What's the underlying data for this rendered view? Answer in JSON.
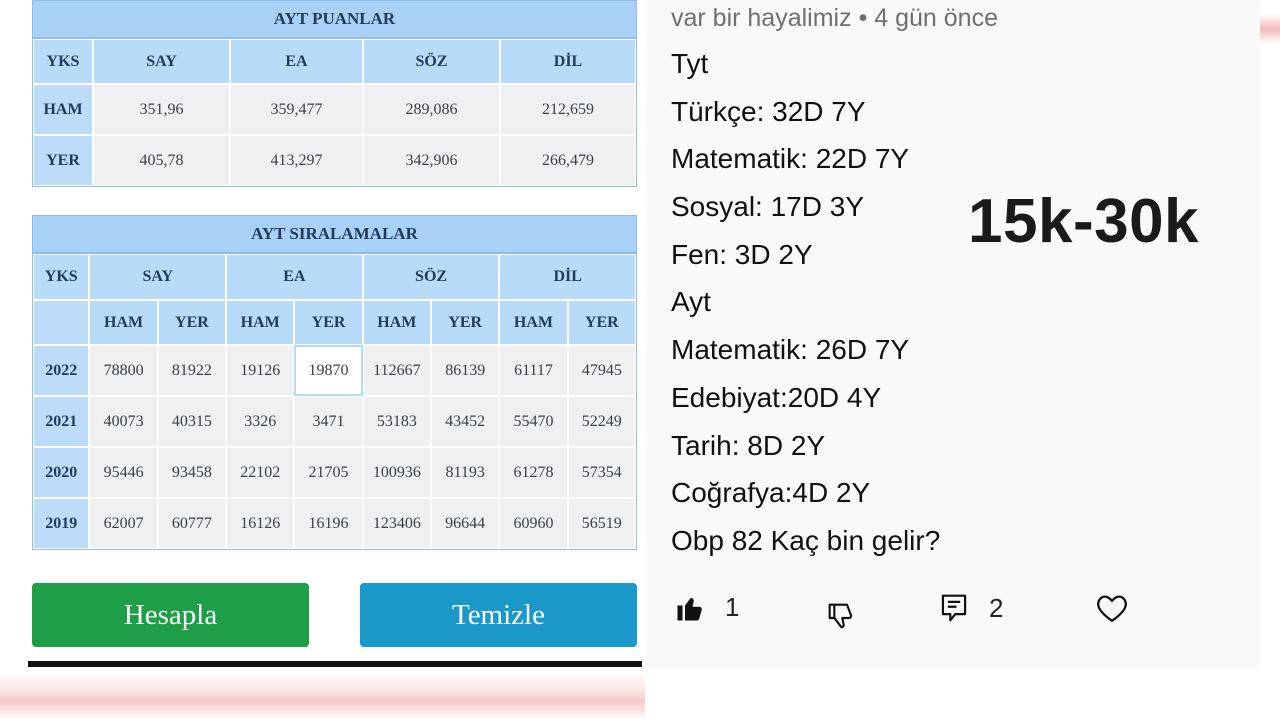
{
  "puanlar": {
    "title": "AYT PUANLAR",
    "header": [
      "YKS",
      "SAY",
      "EA",
      "SÖZ",
      "DİL"
    ],
    "rows": [
      {
        "label": "HAM",
        "values": [
          "351,96",
          "359,477",
          "289,086",
          "212,659"
        ]
      },
      {
        "label": "YER",
        "values": [
          "405,78",
          "413,297",
          "342,906",
          "266,479"
        ]
      }
    ]
  },
  "siralamalar": {
    "title": "AYT SIRALAMALAR",
    "yks_label": "YKS",
    "groups": [
      "SAY",
      "EA",
      "SÖZ",
      "DİL"
    ],
    "sub": [
      "HAM",
      "YER",
      "HAM",
      "YER",
      "HAM",
      "YER",
      "HAM",
      "YER"
    ],
    "rows": [
      {
        "year": "2022",
        "values": [
          "78800",
          "81922",
          "19126",
          "19870",
          "112667",
          "86139",
          "61117",
          "47945"
        ]
      },
      {
        "year": "2021",
        "values": [
          "40073",
          "40315",
          "3326",
          "3471",
          "53183",
          "43452",
          "55470",
          "52249"
        ]
      },
      {
        "year": "2020",
        "values": [
          "95446",
          "93458",
          "22102",
          "21705",
          "100936",
          "81193",
          "61278",
          "57354"
        ]
      },
      {
        "year": "2019",
        "values": [
          "62007",
          "60777",
          "16126",
          "16196",
          "123406",
          "96644",
          "60960",
          "56519"
        ]
      }
    ]
  },
  "buttons": {
    "calculate": "Hesapla",
    "clear": "Temizle"
  },
  "comment": {
    "author": "var bir hayalimiz",
    "time": "4 gün önce",
    "lines": [
      "Tyt",
      "Türkçe: 32D 7Y",
      "Matematik: 22D 7Y",
      "Sosyal: 17D 3Y",
      "Fen: 3D 2Y",
      "Ayt",
      "Matematik: 26D 7Y",
      "Edebiyat:20D 4Y",
      "Tarih: 8D 2Y",
      "Coğrafya:4D 2Y",
      "Obp 82 Kaç bin gelir?"
    ],
    "likes": "1",
    "replies": "2"
  },
  "overlay": {
    "range": "15k-30k"
  },
  "colors": {
    "calculate": "#1e9e46",
    "clear": "#1a98c8",
    "table_header": "#a9d1f7"
  },
  "icons": {
    "like": "thumbs-up-icon",
    "dislike": "thumbs-down-icon",
    "reply": "comment-icon",
    "heart": "heart-icon"
  }
}
